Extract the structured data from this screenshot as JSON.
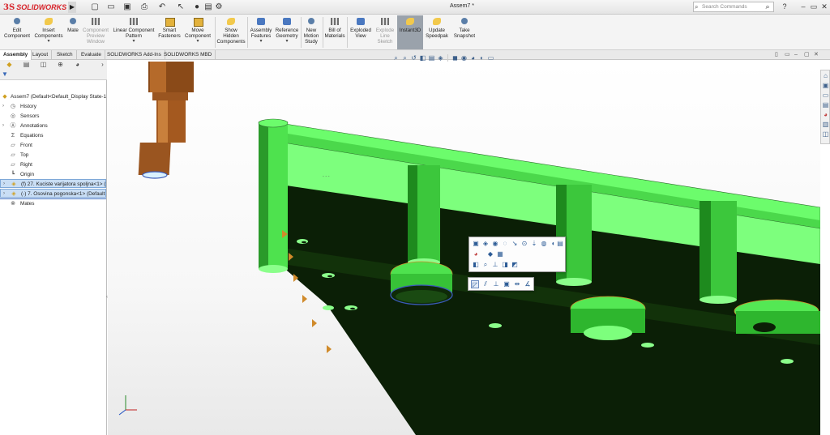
{
  "app": {
    "brand": "SOLIDWORKS",
    "document_title": "Assem7 *",
    "search_placeholder": "Search Commands",
    "help": "?"
  },
  "commands": [
    {
      "label": "Edit\nComponent",
      "icon": "edit-component-icon"
    },
    {
      "label": "Insert\nComponents",
      "icon": "insert-components-icon"
    },
    {
      "label": "Mate",
      "icon": "mate-icon"
    },
    {
      "label": "Component\nPreview\nWindow",
      "icon": "preview-window-icon"
    },
    {
      "label": "Linear Component\nPattern",
      "icon": "linear-pattern-icon"
    },
    {
      "label": "Smart\nFasteners",
      "icon": "smart-fasteners-icon"
    },
    {
      "label": "Move\nComponent",
      "icon": "move-component-icon"
    },
    {
      "label": "Show\nHidden\nComponents",
      "icon": "show-hidden-icon"
    },
    {
      "label": "Assembly\nFeatures",
      "icon": "assembly-features-icon"
    },
    {
      "label": "Reference\nGeometry",
      "icon": "reference-geometry-icon"
    },
    {
      "label": "New\nMotion\nStudy",
      "icon": "motion-study-icon"
    },
    {
      "label": "Bill of\nMaterials",
      "icon": "bom-icon"
    },
    {
      "label": "Exploded\nView",
      "icon": "exploded-view-icon"
    },
    {
      "label": "Explode\nLine\nSketch",
      "icon": "explode-line-icon"
    },
    {
      "label": "Instant3D",
      "icon": "instant3d-icon"
    },
    {
      "label": "Update\nSpeedpak",
      "icon": "speedpak-icon"
    },
    {
      "label": "Take\nSnapshot",
      "icon": "snapshot-icon"
    }
  ],
  "tabs": [
    "Assembly",
    "Layout",
    "Sketch",
    "Evaluate",
    "SOLIDWORKS Add-Ins",
    "SOLIDWORKS MBD"
  ],
  "tree": {
    "root": "Assem7  (Default<Default_Display State-1",
    "items": [
      {
        "label": "History",
        "icon": "history-icon"
      },
      {
        "label": "Sensors",
        "icon": "sensors-icon"
      },
      {
        "label": "Annotations",
        "icon": "annotations-icon"
      },
      {
        "label": "Equations",
        "icon": "equations-icon"
      },
      {
        "label": "Front",
        "icon": "plane-icon"
      },
      {
        "label": "Top",
        "icon": "plane-icon"
      },
      {
        "label": "Right",
        "icon": "plane-icon"
      },
      {
        "label": "Origin",
        "icon": "origin-icon"
      },
      {
        "label": "(f) 27. Kuciste varijatora spoljna<1> (",
        "icon": "part-icon"
      },
      {
        "label": "(-) 7. Osovina pogonska<1> (Default",
        "icon": "part-icon"
      },
      {
        "label": "Mates",
        "icon": "mates-icon"
      }
    ]
  },
  "colors": {
    "part_green": "#6cfc6c",
    "part_dark": "#0b1f06",
    "shaft_brown": "#a4591f",
    "accent_red": "#d8232a",
    "selection_blue": "#c9def5"
  }
}
